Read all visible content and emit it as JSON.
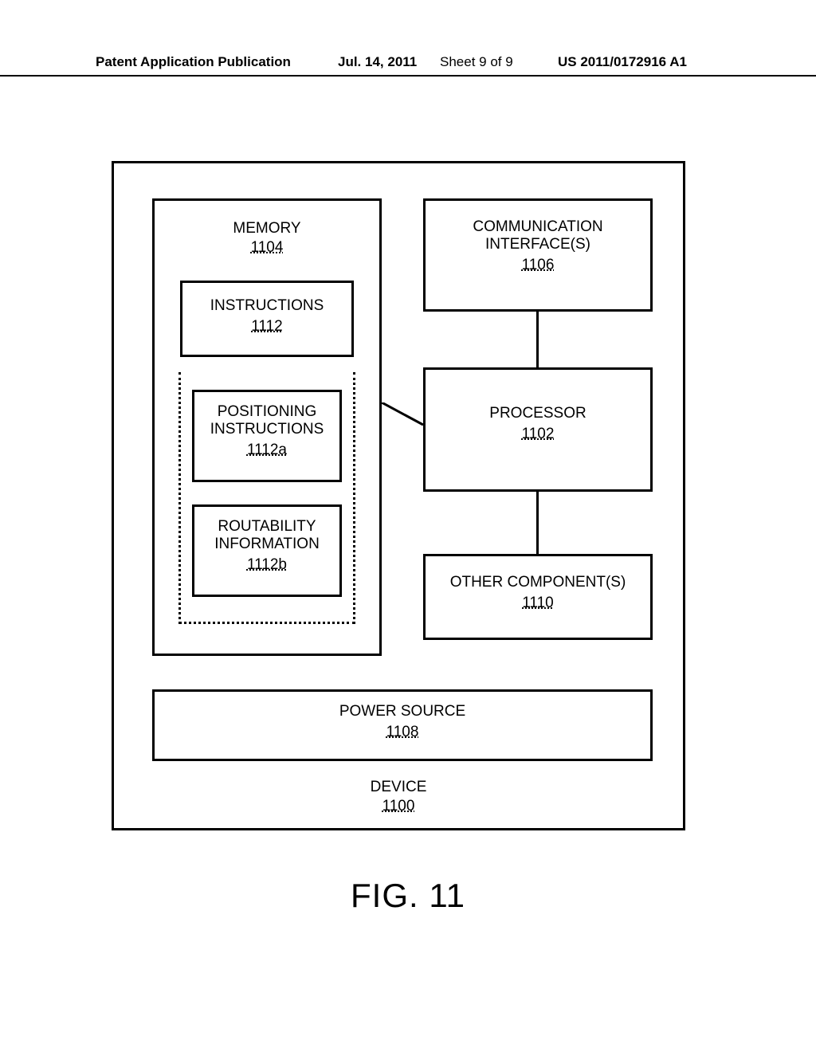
{
  "header": {
    "publication_label": "Patent Application Publication",
    "date": "Jul. 14, 2011",
    "sheet": "Sheet 9 of 9",
    "pub_number": "US 2011/0172916 A1"
  },
  "device": {
    "label": "DEVICE",
    "ref": "1100"
  },
  "memory": {
    "label": "MEMORY",
    "ref": "1104"
  },
  "instructions": {
    "label": "INSTRUCTIONS",
    "ref": "1112"
  },
  "positioning": {
    "label1": "POSITIONING",
    "label2": "INSTRUCTIONS",
    "ref": "1112a"
  },
  "routability": {
    "label1": "ROUTABILITY",
    "label2": "INFORMATION",
    "ref": "1112b"
  },
  "communication": {
    "label1": "COMMUNICATION",
    "label2": "INTERFACE(S)",
    "ref": "1106"
  },
  "processor": {
    "label": "PROCESSOR",
    "ref": "1102"
  },
  "other": {
    "label": "OTHER COMPONENT(S)",
    "ref": "1110"
  },
  "power": {
    "label": "POWER SOURCE",
    "ref": "1108"
  },
  "figure": {
    "label": "FIG. 11"
  }
}
